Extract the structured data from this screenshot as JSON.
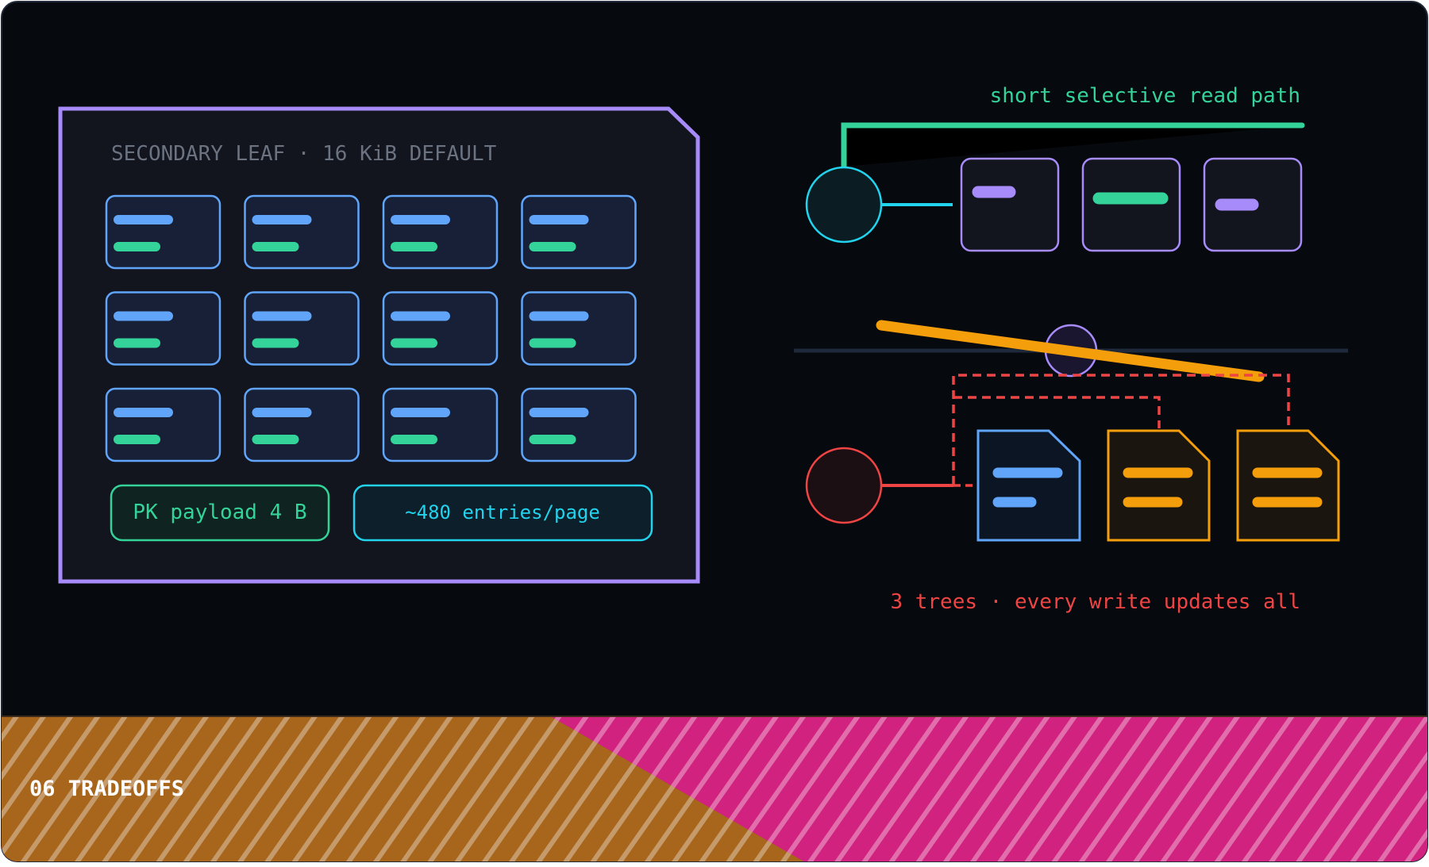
{
  "leaf_panel": {
    "title": "SECONDARY LEAF · 16 KiB DEFAULT",
    "entry_rows": 3,
    "entry_cols": 4,
    "badge_payload": "PK payload 4 B",
    "badge_entries": "~480 entries/page"
  },
  "read_path": {
    "label": "short selective read path"
  },
  "write_path": {
    "label": "3 trees · every write updates all"
  },
  "footer": {
    "section_label": "06 TRADEOFFS"
  },
  "colors": {
    "background": "#06090d",
    "panel": "#12141e",
    "violet": "#a78bfa",
    "blue": "#60a5fa",
    "green": "#34d399",
    "cyan": "#22d3ee",
    "red": "#ef4444",
    "amber": "#f59e0b",
    "stripe_brown": "#a8651c",
    "stripe_magenta": "#d12280"
  },
  "icons": [
    "leaf-page-icon",
    "index-node-icon",
    "document-page-icon",
    "tradeoff-slash-icon"
  ]
}
